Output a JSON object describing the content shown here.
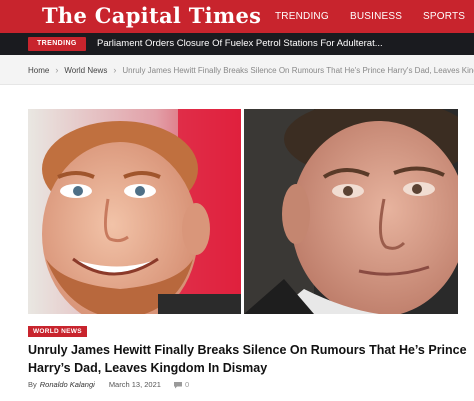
{
  "header": {
    "logo": "The Capital Times",
    "nav": [
      {
        "label": "TRENDING"
      },
      {
        "label": "BUSINESS"
      },
      {
        "label": "SPORTS"
      }
    ]
  },
  "ticker": {
    "badge": "TRENDING",
    "headline": "Parliament Orders Closure Of Fuelex Petrol Stations For Adulterat..."
  },
  "breadcrumb": {
    "home": "Home",
    "category": "World News",
    "current": "Unruly James Hewitt Finally Breaks Silence On Rumours That He's Prince Harry's Dad, Leaves Kingdom In Dismay"
  },
  "article": {
    "category": "WORLD NEWS",
    "title": "Unruly James Hewitt Finally Breaks Silence On Rumours That He’s Prince Harry’s Dad, Leaves Kingdom In Dismay",
    "by_label": "By",
    "author": "Ronaldo Kalangi",
    "date": "March 13, 2021",
    "comments": "0",
    "comment_icon": "comment-icon"
  },
  "colors": {
    "brand_red": "#c8242d",
    "ticker_bg": "#1a1b1f"
  }
}
